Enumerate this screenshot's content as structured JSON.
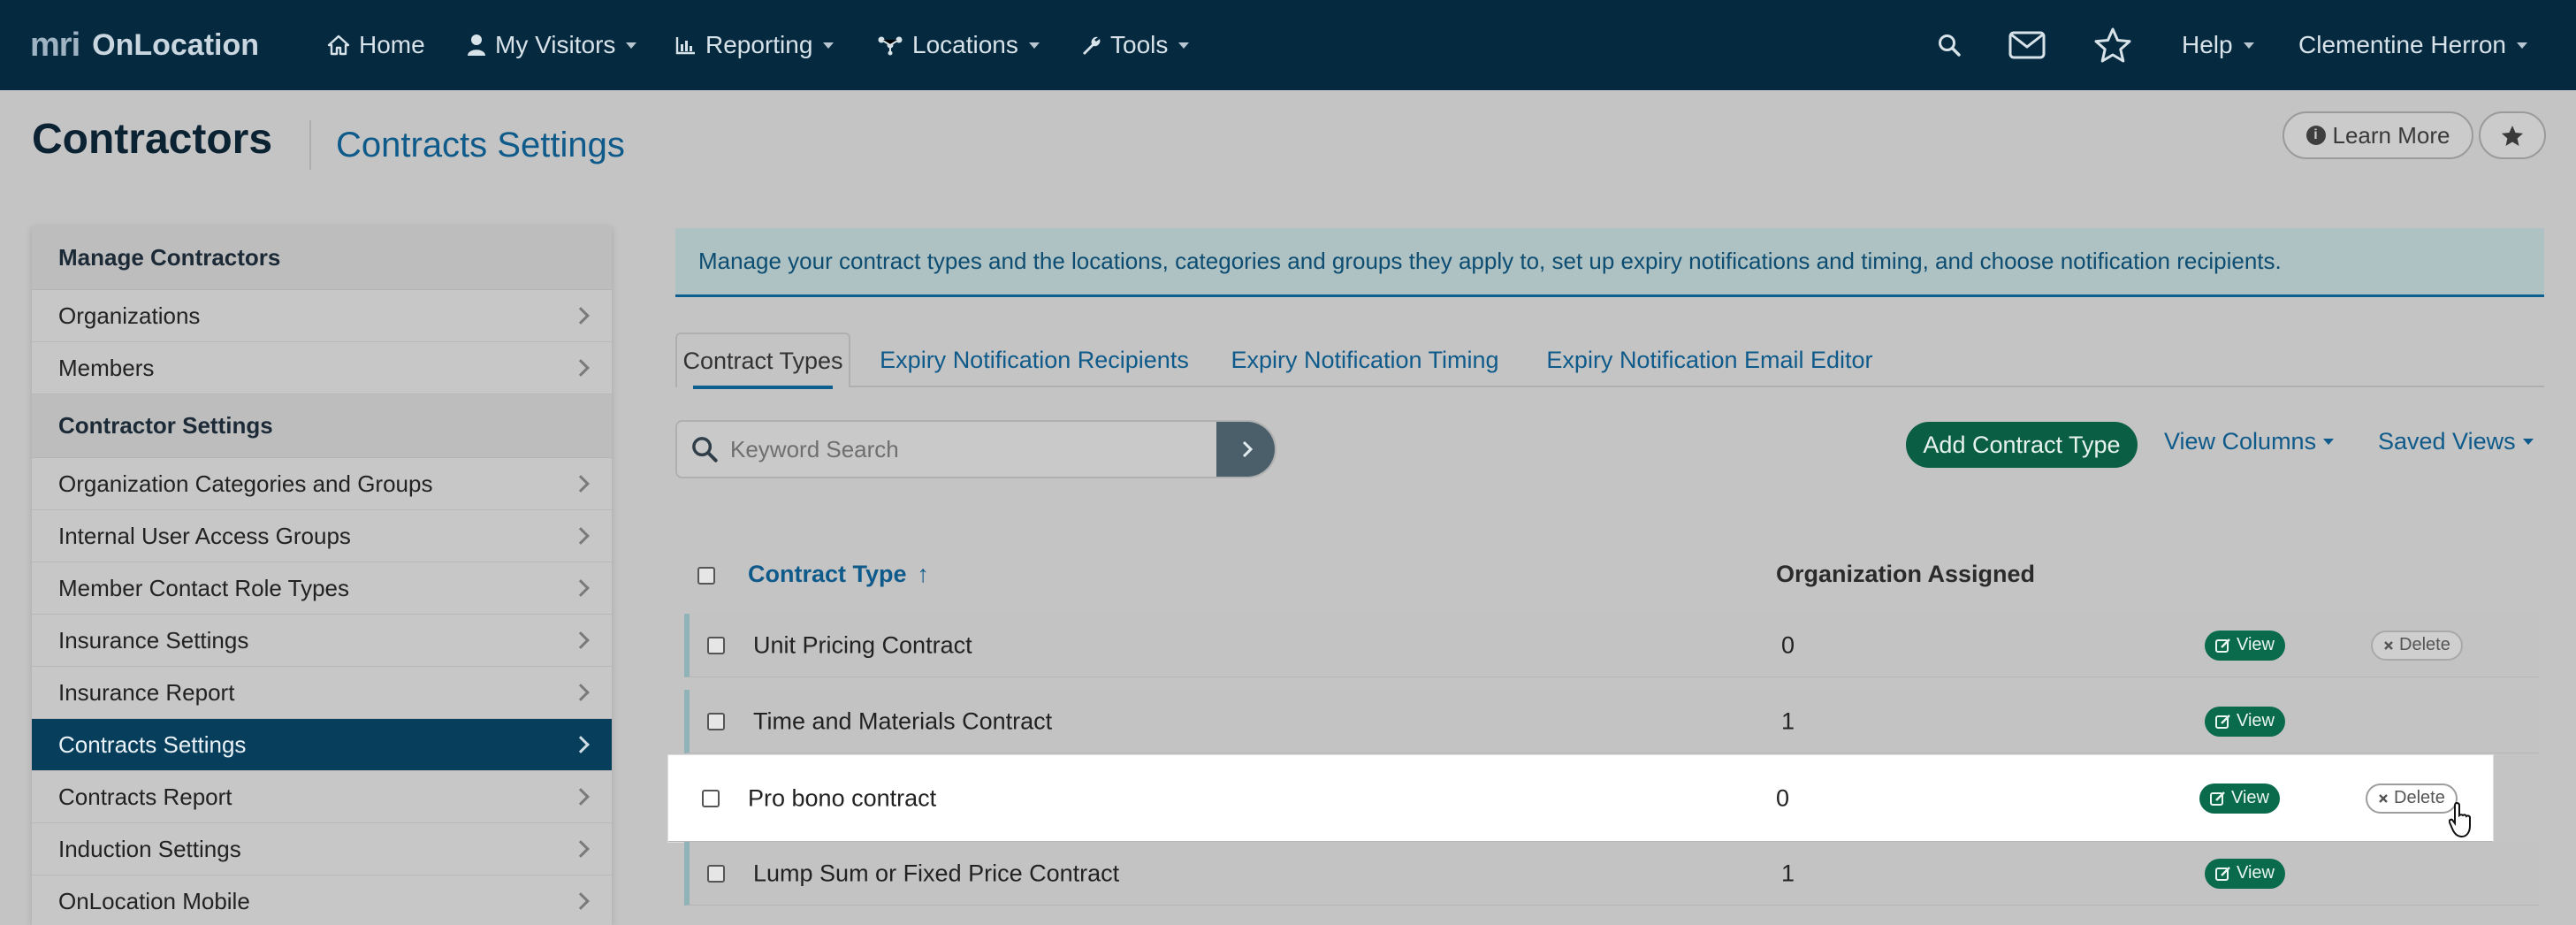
{
  "topnav": {
    "brand_mark": "mri",
    "brand_name": "OnLocation",
    "items": [
      {
        "label": "Home",
        "icon": "home-icon",
        "has_caret": false
      },
      {
        "label": "My Visitors",
        "icon": "user-icon",
        "has_caret": true
      },
      {
        "label": "Reporting",
        "icon": "chart-icon",
        "has_caret": true
      },
      {
        "label": "Locations",
        "icon": "network-icon",
        "has_caret": true
      },
      {
        "label": "Tools",
        "icon": "wrench-icon",
        "has_caret": true
      }
    ],
    "help_label": "Help",
    "user_name": "Clementine Herron"
  },
  "header": {
    "title": "Contractors",
    "subtitle": "Contracts Settings",
    "learn_more": "Learn More"
  },
  "sidebar": {
    "sections": [
      {
        "title": "Manage Contractors",
        "items": [
          {
            "label": "Organizations",
            "active": false
          },
          {
            "label": "Members",
            "active": false
          }
        ]
      },
      {
        "title": "Contractor Settings",
        "items": [
          {
            "label": "Organization Categories and Groups",
            "active": false
          },
          {
            "label": "Internal User Access Groups",
            "active": false
          },
          {
            "label": "Member Contact Role Types",
            "active": false
          },
          {
            "label": "Insurance Settings",
            "active": false
          },
          {
            "label": "Insurance Report",
            "active": false
          },
          {
            "label": "Contracts Settings",
            "active": true
          },
          {
            "label": "Contracts Report",
            "active": false
          },
          {
            "label": "Induction Settings",
            "active": false
          },
          {
            "label": "OnLocation Mobile",
            "active": false
          }
        ]
      }
    ]
  },
  "banner": {
    "text": "Manage your contract types and the locations, categories and groups they apply to, set up expiry notifications and timing, and choose notification recipients."
  },
  "tabs": [
    {
      "label": "Contract Types",
      "active": true
    },
    {
      "label": "Expiry Notification Recipients",
      "active": false
    },
    {
      "label": "Expiry Notification Timing",
      "active": false
    },
    {
      "label": "Expiry Notification Email Editor",
      "active": false
    }
  ],
  "toolbar": {
    "search_placeholder": "Keyword Search",
    "add_label": "Add Contract Type",
    "view_columns": "View Columns",
    "saved_views": "Saved Views"
  },
  "table": {
    "columns": {
      "type": "Contract Type",
      "sort_indicator": "↑",
      "org": "Organization Assigned"
    },
    "rows": [
      {
        "name": "Unit Pricing Contract",
        "org": "0",
        "view": "View",
        "delete": "Delete",
        "has_delete": true
      },
      {
        "name": "Time and Materials Contract",
        "org": "1",
        "view": "View",
        "delete": "",
        "has_delete": false
      },
      {
        "name": "Pro bono contract",
        "org": "0",
        "view": "View",
        "delete": "Delete",
        "has_delete": true,
        "highlighted": true
      },
      {
        "name": "Lump Sum or Fixed Price Contract",
        "org": "1",
        "view": "View",
        "delete": "",
        "has_delete": false
      }
    ]
  },
  "colors": {
    "nav_bg": "#052a40",
    "accent_link": "#0e5a8a",
    "primary_green": "#0a5e44",
    "active_sidebar": "#073e5b"
  }
}
